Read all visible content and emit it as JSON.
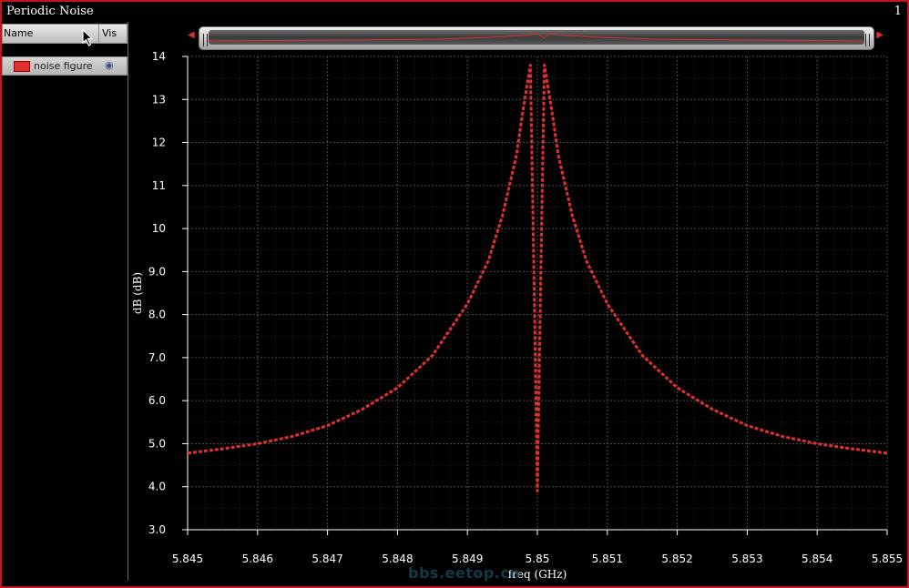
{
  "window": {
    "title": "Periodic Noise",
    "number": "1"
  },
  "trace_list": {
    "columns": [
      "Name",
      "Vis"
    ],
    "items": [
      {
        "name": "noise figure",
        "color": "#e03030",
        "visible_icon": "eye-icon"
      }
    ]
  },
  "watermark": "bbs.eetop.cn",
  "chart_data": {
    "type": "line",
    "xlabel": "freq (GHz)",
    "ylabel": "dB (dB)",
    "xlim": [
      5.845,
      5.855
    ],
    "ylim": [
      3.0,
      14.0
    ],
    "xticks": [
      "5.845",
      "5.846",
      "5.847",
      "5.848",
      "5.849",
      "5.85",
      "5.851",
      "5.852",
      "5.853",
      "5.854",
      "5.855"
    ],
    "yticks": [
      "3.0",
      "4.0",
      "5.0",
      "6.0",
      "7.0",
      "8.0",
      "9.0",
      "10",
      "11",
      "12",
      "13",
      "14"
    ],
    "grid": true,
    "series": [
      {
        "name": "noise figure",
        "color": "#e03030",
        "style": "dashed",
        "x": [
          5.845,
          5.8455,
          5.846,
          5.8465,
          5.847,
          5.8475,
          5.848,
          5.8485,
          5.849,
          5.8493,
          5.8495,
          5.8497,
          5.8498,
          5.8499,
          5.84995,
          5.85,
          5.85005,
          5.8501,
          5.8502,
          5.8503,
          5.8505,
          5.8507,
          5.851,
          5.8515,
          5.852,
          5.8525,
          5.853,
          5.8535,
          5.854,
          5.8545,
          5.855
        ],
        "y": [
          4.78,
          4.88,
          5.0,
          5.17,
          5.42,
          5.8,
          6.3,
          7.05,
          8.25,
          9.25,
          10.3,
          11.7,
          12.8,
          13.8,
          9.0,
          3.9,
          9.0,
          13.8,
          12.8,
          11.7,
          10.3,
          9.25,
          8.25,
          7.05,
          6.3,
          5.8,
          5.42,
          5.17,
          5.0,
          4.88,
          4.78
        ]
      }
    ]
  }
}
